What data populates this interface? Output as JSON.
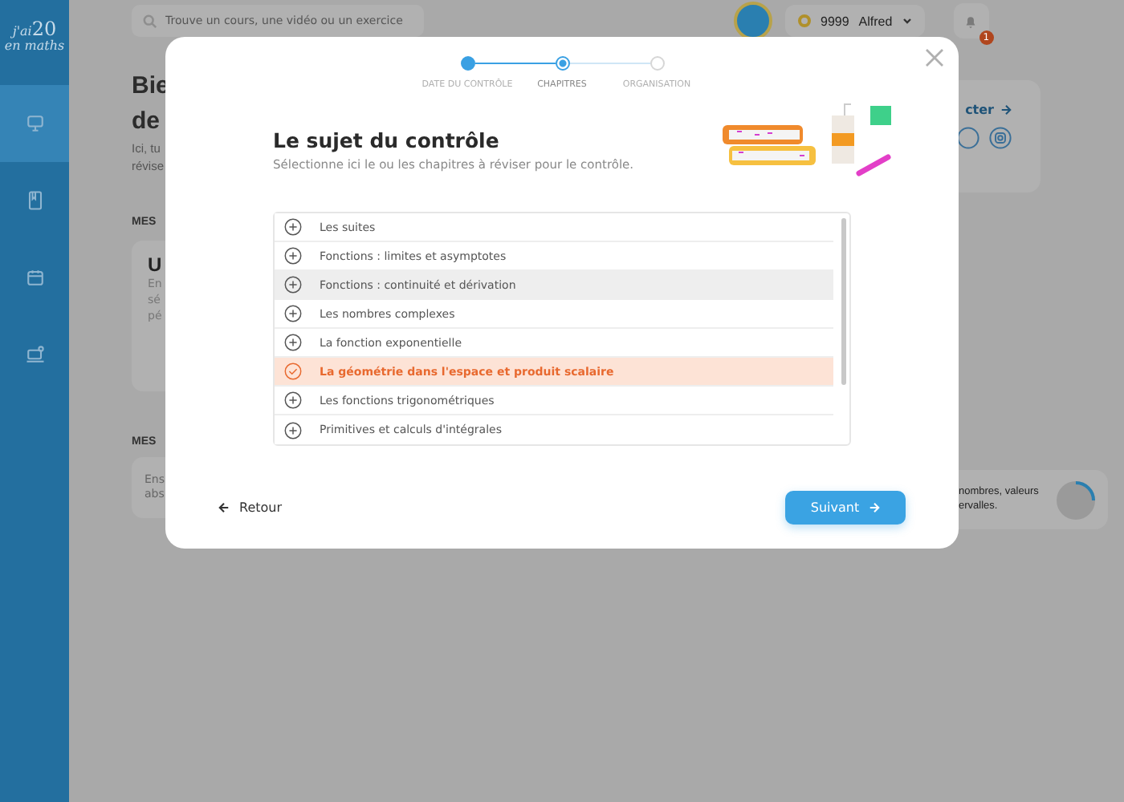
{
  "sidebar": {
    "logo": {
      "top": "j'ai",
      "number": "20",
      "small": "en",
      "bottom": "maths"
    },
    "items": [
      {
        "kind": "board",
        "selected": true
      },
      {
        "kind": "book",
        "selected": false
      },
      {
        "kind": "calendar",
        "selected": false
      },
      {
        "kind": "laptop",
        "selected": false
      }
    ]
  },
  "header": {
    "search": {
      "placeholder": "Trouve un cours, une vidéo ou un exercice"
    },
    "coins": "9999",
    "user": "Alfred",
    "notifications": "1"
  },
  "background": {
    "heading": [
      "Bie",
      "de"
    ],
    "intro": [
      "Ici, tu",
      "révise"
    ],
    "section_1": "MES",
    "card_1": {
      "title": "U",
      "lines": [
        "En",
        "sé",
        "pé"
      ]
    },
    "section_2": "MES",
    "card_2": [
      "Ens",
      "abs"
    ],
    "right_card_link": "cter",
    "right_card_2": [
      "nombres, valeurs",
      "ervalles."
    ]
  },
  "modal": {
    "steps": [
      {
        "label": "DATE DU CONTRÔLE",
        "completed": true,
        "selected": false
      },
      {
        "label": "CHAPITRES",
        "completed": false,
        "selected": true
      },
      {
        "label": "ORGANISATION",
        "completed": false,
        "selected": false
      }
    ],
    "title": "Le sujet du contrôle",
    "subtitle": "Sélectionne ici le ou les chapitres à réviser pour le contrôle.",
    "chapters": [
      {
        "label": "Les suites",
        "selected": false,
        "hovered": false
      },
      {
        "label": "Fonctions : limites et asymptotes",
        "selected": false,
        "hovered": false
      },
      {
        "label": "Fonctions : continuité et dérivation",
        "selected": false,
        "hovered": true
      },
      {
        "label": "Les nombres complexes",
        "selected": false,
        "hovered": false
      },
      {
        "label": "La fonction exponentielle",
        "selected": false,
        "hovered": false
      },
      {
        "label": "La géométrie dans l'espace et produit scalaire",
        "selected": true,
        "hovered": false
      },
      {
        "label": "Les fonctions trigonométriques",
        "selected": false,
        "hovered": false
      },
      {
        "label": "Primitives et calculs d'intégrales",
        "selected": false,
        "hovered": false
      }
    ],
    "back": "Retour",
    "next": "Suivant"
  }
}
